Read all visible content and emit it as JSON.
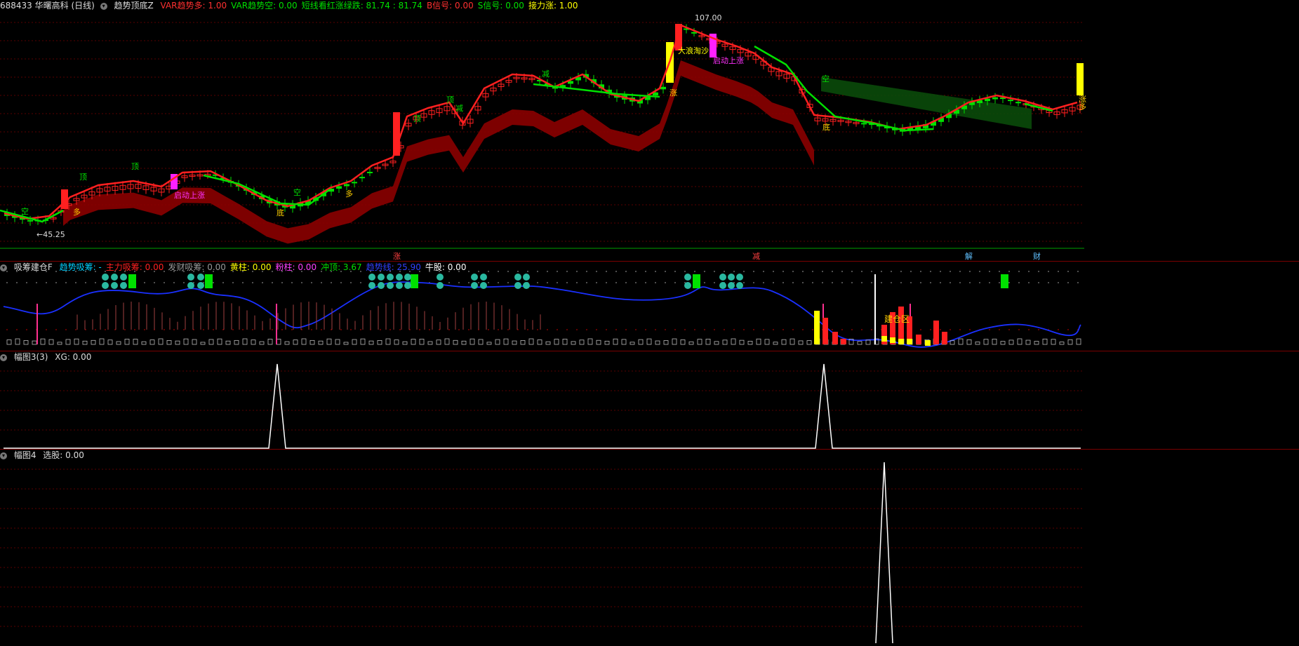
{
  "main": {
    "stock": "688433 华曙高科 (日线)",
    "indicator": "趋势顶底Z",
    "items": [
      {
        "text": "VAR趋势多: 1.00",
        "color": "#ff3030"
      },
      {
        "text": "VAR趋势空: 0.00",
        "color": "#00e000"
      },
      {
        "text": "短线看红涨绿跌: 81.74 : 81.74",
        "color": "#00e000"
      },
      {
        "text": "B信号: 0.00",
        "color": "#ff3030"
      },
      {
        "text": "S信号: 0.00",
        "color": "#00e000"
      },
      {
        "text": "接力涨: 1.00",
        "color": "#ffff00"
      }
    ],
    "high_label": "107.00",
    "low_label": "←45.25",
    "labels": [
      "空",
      "多",
      "顶",
      "顶",
      "启动上涨",
      "空",
      "底",
      "多",
      "顶",
      "顶",
      "减",
      "减",
      "大浪淘沙",
      "启动上涨",
      "涨",
      "空",
      "底",
      "涨",
      "多"
    ],
    "events": [
      "涨",
      "减",
      "解",
      "财"
    ]
  },
  "sub1": {
    "indicator": "吸筹建仓F",
    "items": [
      {
        "text": "趋势吸筹: -",
        "color": "#00d0ff"
      },
      {
        "text": "主力吸筹: 0.00",
        "color": "#ff2020"
      },
      {
        "text": "发财吸筹: 0.00",
        "color": "#999999"
      },
      {
        "text": "黄柱: 0.00",
        "color": "#ffff00"
      },
      {
        "text": "粉柱: 0.00",
        "color": "#ff40ff"
      },
      {
        "text": "冲顶: 3.67",
        "color": "#00e000"
      },
      {
        "text": "趋势线: 25.90",
        "color": "#3040ff"
      },
      {
        "text": "牛股: 0.00",
        "color": "#ffffff"
      }
    ],
    "zone_label": "建仓区"
  },
  "sub2": {
    "indicator": "幅图3(3)",
    "items": [
      {
        "text": "XG: 0.00",
        "color": "#dddddd"
      }
    ]
  },
  "sub3": {
    "indicator": "幅图4",
    "items": [
      {
        "text": "选股: 0.00",
        "color": "#dddddd"
      }
    ]
  },
  "colors": {
    "up": "#ff2020",
    "down": "#00e000",
    "trend_up": "#ff2020",
    "trend_down": "#00e000",
    "ribbon": "#8b0000",
    "blue": "#1a30ff"
  }
}
